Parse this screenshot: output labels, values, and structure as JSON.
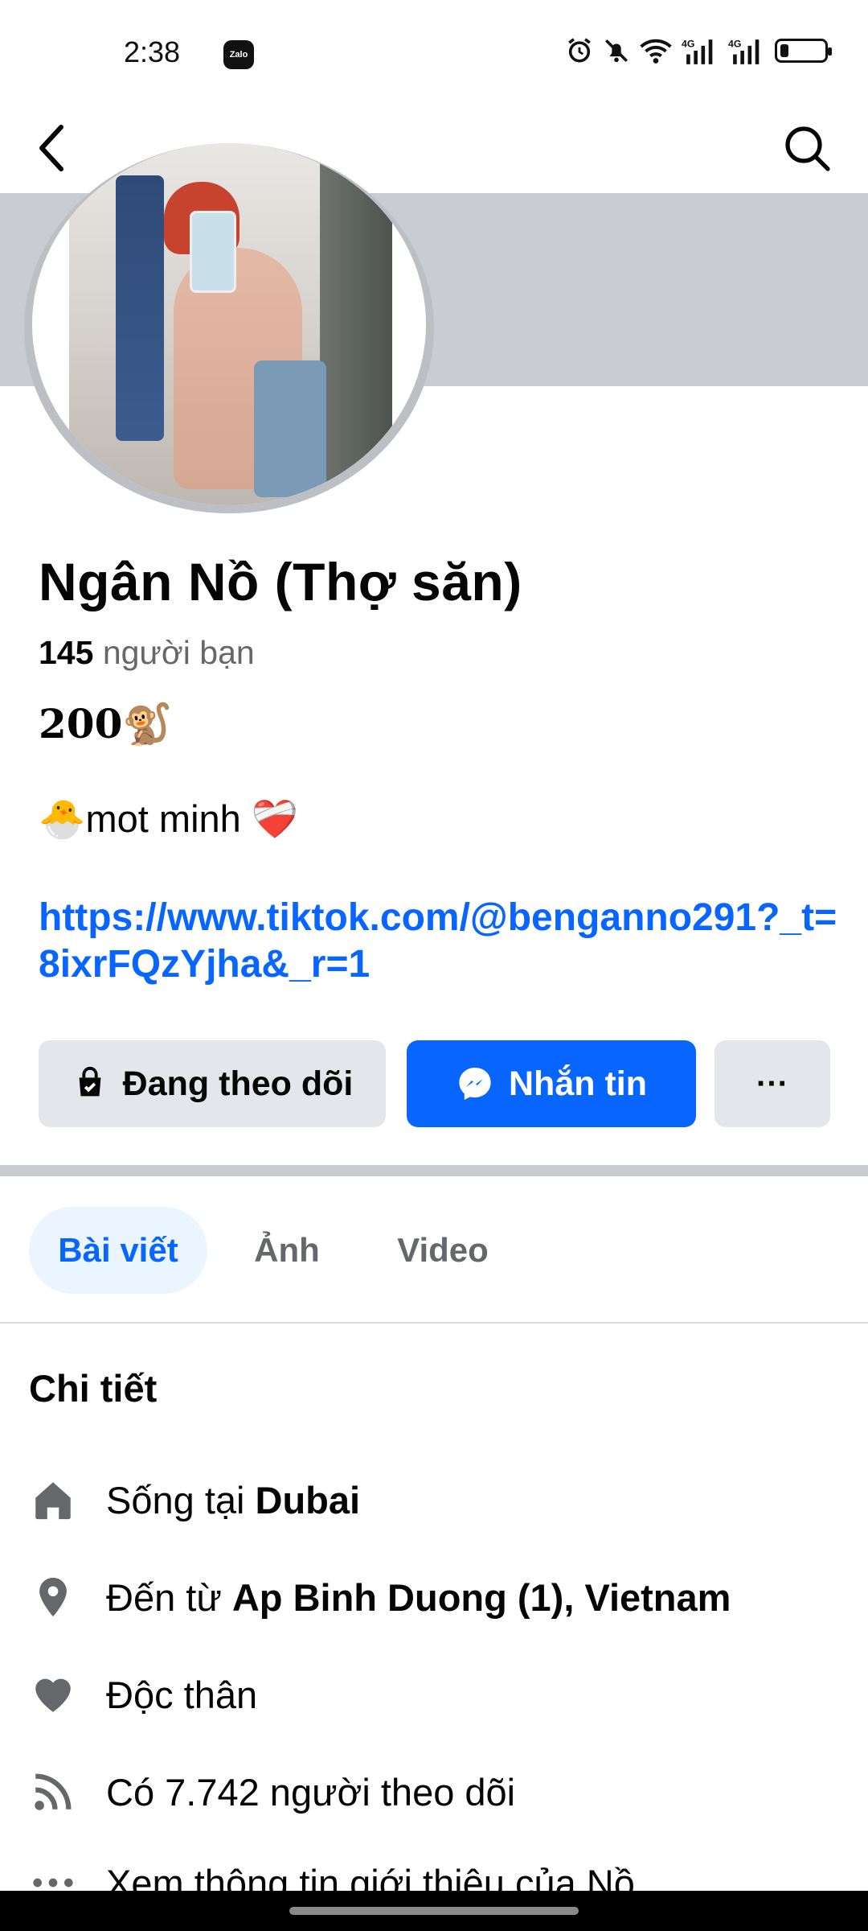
{
  "status": {
    "time": "2:38",
    "zalo_label": "Zalo",
    "network1": "4G",
    "network2": "4G",
    "battery_level": 0.2
  },
  "profile": {
    "name": "Ngân Nồ (Thợ săn)",
    "friends_count": "145",
    "friends_label": "người bạn",
    "bio_line1": "200🐒",
    "bio_line2": "🐣mot minh ❤️‍🩹",
    "link": "https://www.tiktok.com/@benganno291?_t=8ixrFQzYjha&_r=1"
  },
  "actions": {
    "follow_label": "Đang theo dõi",
    "message_label": "Nhắn tin",
    "more_label": "···"
  },
  "tabs": [
    "Bài viết",
    "Ảnh",
    "Video"
  ],
  "details": {
    "title": "Chi tiết",
    "lives_prefix": "Sống tại ",
    "lives_value": "Dubai",
    "from_prefix": "Đến từ ",
    "from_value": "Ap Binh Duong (1), Vietnam",
    "relationship": "Độc thân",
    "followers": "Có 7.742 người theo dõi",
    "see_about": "Xem thông tin giới thiệu của Nồ"
  },
  "colors": {
    "brand_blue": "#0866ff",
    "button_gray": "#e4e6eb",
    "secondary_text": "#65676b"
  }
}
